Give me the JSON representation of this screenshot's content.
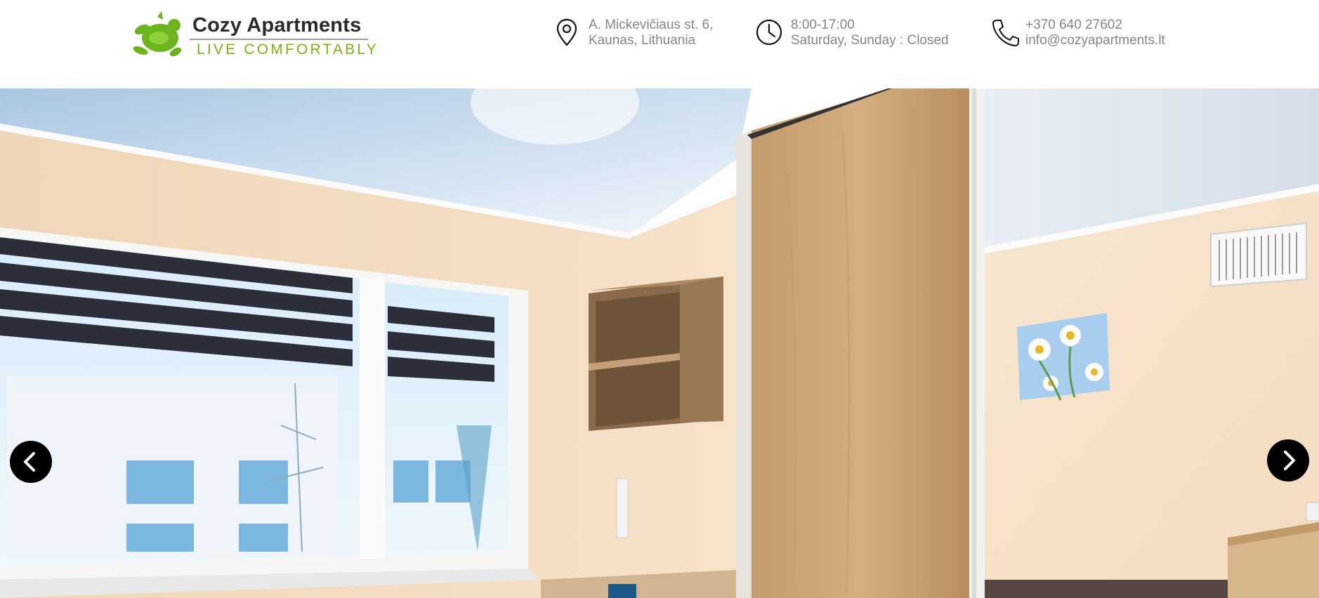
{
  "brand": {
    "name": "Cozy Apartments",
    "tagline": "LIVE COMFORTABLY",
    "accent_color": "#7ab317"
  },
  "contact_bar": {
    "address": {
      "icon": "map-pin-icon",
      "line1": "A. Mickevičiaus st. 6,",
      "line2": "Kaunas, Lithuania"
    },
    "hours": {
      "icon": "clock-icon",
      "line1": "8:00-17:00",
      "line2": "Saturday, Sunday : Closed"
    },
    "contact": {
      "icon": "phone-icon",
      "phone": "+370 640 27602",
      "email": "info@cozyapartments.lt"
    }
  },
  "slider": {
    "prev_icon": "chevron-left-icon",
    "next_icon": "chevron-right-icon"
  }
}
